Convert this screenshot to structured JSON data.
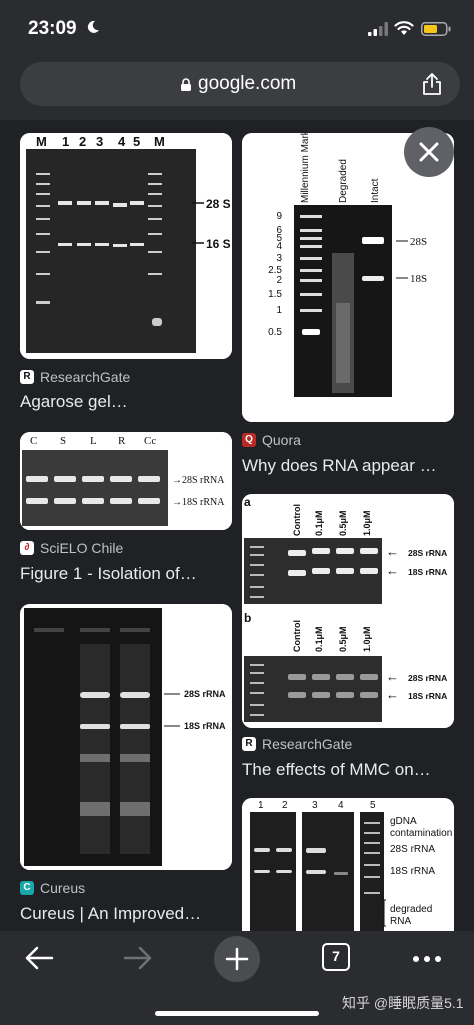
{
  "status_bar": {
    "time": "23:09"
  },
  "address_bar": {
    "url": "google.com"
  },
  "results": [
    {
      "source": "ResearchGate",
      "title": "Agarose gel…",
      "image_labels": {
        "lanes": [
          "M",
          "1",
          "2",
          "3",
          "4",
          "5",
          "M"
        ],
        "bands": [
          "28 S",
          "16 S"
        ]
      }
    },
    {
      "source": "Quora",
      "title": "Why does RNA appear …",
      "image_labels": {
        "columns": [
          "Millennium Markers™",
          "Degraded",
          "Intact"
        ],
        "markers": [
          "9",
          "6",
          "5",
          "4",
          "3",
          "2.5",
          "2",
          "1.5",
          "1",
          "0.5"
        ],
        "bands": [
          "28S",
          "18S"
        ]
      }
    },
    {
      "source": "SciELO Chile",
      "title": "Figure 1 - Isolation of…",
      "image_labels": {
        "lanes": [
          "C",
          "S",
          "L",
          "R",
          "Cc"
        ],
        "bands": [
          "28S rRNA",
          "18S rRNA"
        ]
      }
    },
    {
      "source": "ResearchGate",
      "title": "The effects of MMC on…",
      "image_labels": {
        "panel_a": "a",
        "panel_b": "b",
        "lanes": [
          "Control",
          "0.1μM",
          "0.5μM",
          "1.0μM"
        ],
        "bands": [
          "28S rRNA",
          "18S rRNA"
        ]
      }
    },
    {
      "source": "Cureus",
      "title": "Cureus | An Improved…",
      "image_labels": {
        "bands": [
          "28S rRNA",
          "18S rRNA"
        ]
      }
    },
    {
      "source": "",
      "title": "",
      "image_labels": {
        "lanes": [
          "1",
          "2",
          "3",
          "4",
          "5"
        ],
        "bands": [
          "gDNA",
          "contamination",
          "28S rRNA",
          "18S rRNA",
          "degraded",
          "RNA"
        ]
      }
    }
  ],
  "bottom_bar": {
    "tab_count": "7",
    "watermark": "知乎 @睡眠质量5.1"
  },
  "icons": {
    "status": [
      "moon-icon",
      "cellular-signal-icon",
      "wifi-icon",
      "battery-icon"
    ],
    "toolbar": [
      "lock-icon",
      "share-icon",
      "close-icon",
      "back-arrow-icon",
      "forward-arrow-icon",
      "plus-icon",
      "tab-switcher-icon",
      "more-dots-icon"
    ]
  },
  "colors": {
    "background": "#202124",
    "chrome": "#2b2c2f",
    "battery": "#f5c518"
  }
}
